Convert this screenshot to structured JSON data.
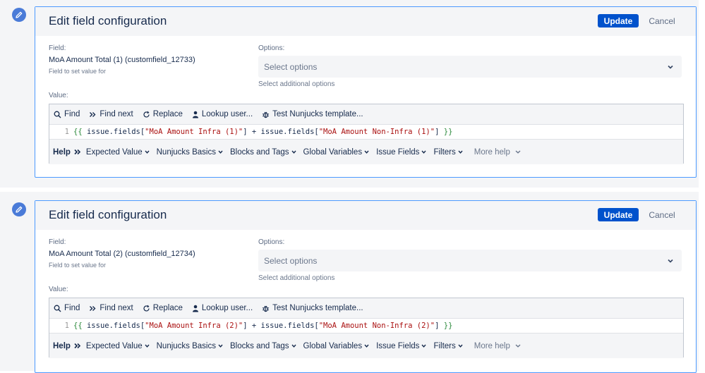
{
  "cards": [
    {
      "title": "Edit field configuration",
      "update_label": "Update",
      "cancel_label": "Cancel",
      "field_label": "Field:",
      "field_name": "MoA Amount Total (1) (customfield_12733)",
      "field_help": "Field to set value for",
      "options_label": "Options:",
      "select_placeholder": "Select options",
      "options_help": "Select additional options",
      "value_label": "Value:",
      "toolbar": {
        "find": "Find",
        "find_next": "Find next",
        "replace": "Replace",
        "lookup_user": "Lookup user...",
        "test_template": "Test Nunjucks template..."
      },
      "code": {
        "line_number": "1",
        "open": "{{",
        "p1": " issue.fields[",
        "s1": "\"MoA Amount Infra (1)\"",
        "p2": "] + issue.fields[",
        "s2": "\"MoA Amount Non-Infra (1)\"",
        "p3": "] ",
        "close": "}}"
      }
    },
    {
      "title": "Edit field configuration",
      "update_label": "Update",
      "cancel_label": "Cancel",
      "field_label": "Field:",
      "field_name": "MoA Amount Total (2) (customfield_12734)",
      "field_help": "Field to set value for",
      "options_label": "Options:",
      "select_placeholder": "Select options",
      "options_help": "Select additional options",
      "value_label": "Value:",
      "toolbar": {
        "find": "Find",
        "find_next": "Find next",
        "replace": "Replace",
        "lookup_user": "Lookup user...",
        "test_template": "Test Nunjucks template..."
      },
      "code": {
        "line_number": "1",
        "open": "{{",
        "p1": " issue.fields[",
        "s1": "\"MoA Amount Infra (2)\"",
        "p2": "] + issue.fields[",
        "s2": "\"MoA Amount Non-Infra (2)\"",
        "p3": "] ",
        "close": "}}"
      }
    }
  ],
  "help": {
    "title": "Help",
    "items": [
      "Expected Value",
      "Nunjucks Basics",
      "Blocks and Tags",
      "Global Variables",
      "Issue Fields",
      "Filters"
    ],
    "more": "More help"
  },
  "icons": {
    "edit": "pencil-icon",
    "find": "search-icon",
    "find_next": "double-chevron-right-icon",
    "replace": "refresh-icon",
    "lookup": "user-icon",
    "test": "bug-icon",
    "chevron": "chevron-down-icon"
  },
  "colors": {
    "primary": "#0052cc",
    "card_border": "#4c9aff",
    "pencil_badge": "#4a7bd8"
  }
}
